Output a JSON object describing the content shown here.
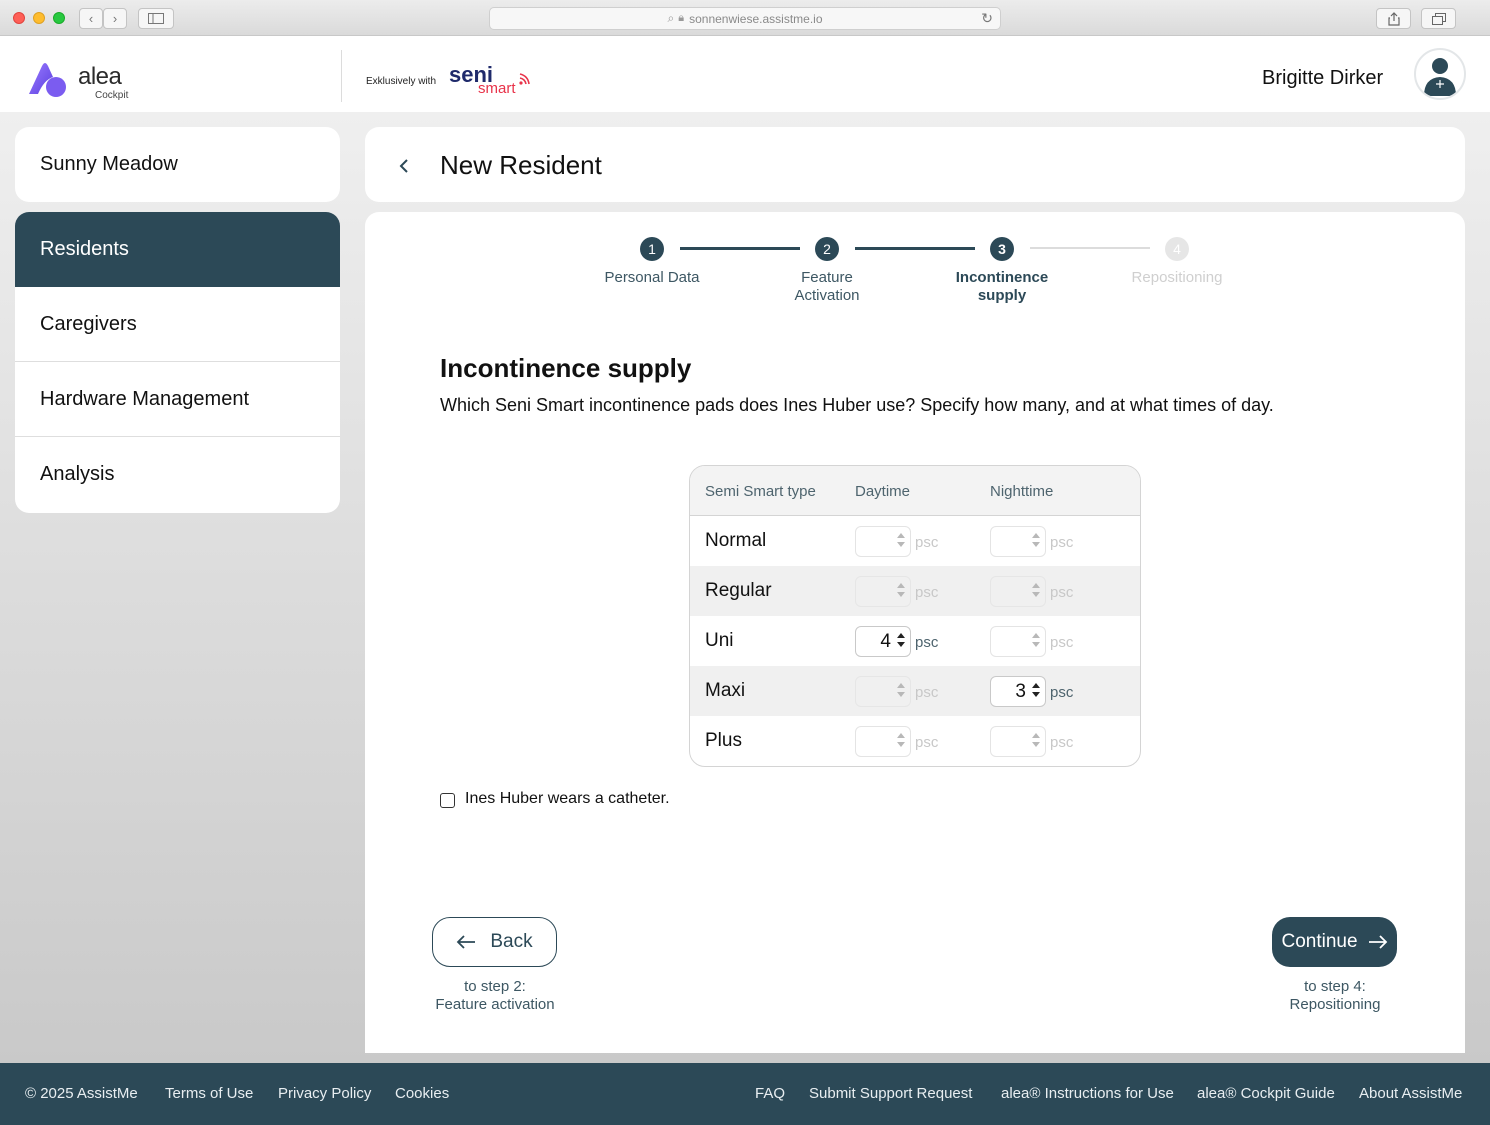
{
  "browser": {
    "url": "sonnenwiese.assistme.io"
  },
  "header": {
    "logo_text": "alea",
    "logo_sub": "Cockpit",
    "exclusive_text": "Exklusively with",
    "partner_logo_top": "seni",
    "partner_logo_bottom": "smart",
    "user_name": "Brigitte Dirker"
  },
  "sidebar": {
    "facility": "Sunny Meadow",
    "items": [
      {
        "label": "Residents",
        "active": true
      },
      {
        "label": "Caregivers",
        "active": false
      },
      {
        "label": "Hardware Management",
        "active": false
      },
      {
        "label": "Analysis",
        "active": false
      }
    ]
  },
  "main": {
    "title": "New Resident",
    "stepper": [
      {
        "number": "1",
        "label": "Personal Data",
        "state": "done"
      },
      {
        "number": "2",
        "label": "Feature Activation",
        "state": "done"
      },
      {
        "number": "3",
        "label": "Incontinence supply",
        "state": "current"
      },
      {
        "number": "4",
        "label": "Repositioning",
        "state": "upcoming"
      }
    ],
    "section_title": "Incontinence supply",
    "section_desc": "Which Seni Smart incontinence pads does Ines Huber use? Specify how many, and at what times of day.",
    "table": {
      "headers": [
        "Semi Smart type",
        "Daytime",
        "Nighttime"
      ],
      "unit": "psc",
      "rows": [
        {
          "type": "Normal",
          "day": "",
          "night": ""
        },
        {
          "type": "Regular",
          "day": "",
          "night": ""
        },
        {
          "type": "Uni",
          "day": "4",
          "night": ""
        },
        {
          "type": "Maxi",
          "day": "",
          "night": "3"
        },
        {
          "type": "Plus",
          "day": "",
          "night": ""
        }
      ]
    },
    "catheter_label": "Ines Huber wears a catheter.",
    "catheter_checked": false,
    "back_button": "Back",
    "back_note_line1": "to step 2:",
    "back_note_line2": "Feature activation",
    "continue_button": "Continue",
    "continue_note_line1": "to step 4:",
    "continue_note_line2": "Repositioning"
  },
  "footer": {
    "copyright": "© 2025 AssistMe",
    "left_links": [
      "Terms of Use",
      "Privacy Policy",
      "Cookies"
    ],
    "right_links": [
      "FAQ",
      "Submit Support Request",
      "alea® Instructions for Use",
      "alea® Cockpit Guide",
      "About AssistMe"
    ]
  },
  "colors": {
    "primary": "#2c4957",
    "logo_purple": "#7b5cf0",
    "seni_navy": "#1f2a6b",
    "seni_red": "#e8334a"
  }
}
